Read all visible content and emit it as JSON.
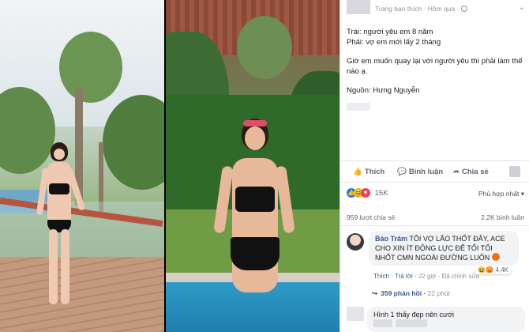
{
  "post": {
    "header_meta": "Trang bạn thích · Hôm qua ·",
    "lines": [
      "Trái: người yêu em 8 năm",
      "Phải: vợ em mới lấy 2 tháng",
      "Giờ em muốn quay lại với người yêu thì phải làm thế nào ạ.",
      "Nguồn: Hưng Nguyễn"
    ]
  },
  "actions": {
    "like": "Thích",
    "comment": "Bình luận",
    "share": "Chia sẻ"
  },
  "reactions": {
    "count": "15K",
    "relevance": "Phù hợp nhất ▾"
  },
  "stats": {
    "comments": "959 lượt chia sẻ",
    "shares": "2,2K bình luận"
  },
  "comment": {
    "author": "Bảo Trâm",
    "text": "TÔI VỢ LÃO THỐT ĐÂY, ACE CHO XIN ÍT ĐỘNG LỰC ĐỂ TỐI TỐI NHỐT CMN NGOÀI ĐƯỜNG LUÔN",
    "like": "Thích",
    "reply": "Trả lời",
    "time": "22 giờ",
    "edited": "Đã chỉnh sửa",
    "reaction_count": "4,4K",
    "replies": "359 phản hồi",
    "replies_time": "22 phút"
  },
  "reply2": {
    "text": "Hình 1 thấy đẹp nên cưới"
  },
  "icons": {
    "globe": "globe-icon",
    "like": "thumbs-up-icon",
    "comment": "comment-icon",
    "share": "share-arrow-icon",
    "chevron": "chevron-down-icon"
  },
  "colors": {
    "link": "#385898",
    "like_blue": "#1877f2",
    "meta_gray": "#90949c"
  }
}
